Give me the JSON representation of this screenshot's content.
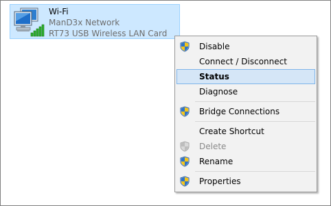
{
  "adapter": {
    "name": "Wi-Fi",
    "network": "ManD3x Network",
    "device": "RT73 USB Wireless LAN Card",
    "icon": "wireless-network-adapter-icon"
  },
  "menu": {
    "items": [
      {
        "label": "Disable",
        "shield": true,
        "disabled": false,
        "highlighted": false
      },
      {
        "label": "Connect / Disconnect",
        "shield": false,
        "disabled": false,
        "highlighted": false
      },
      {
        "label": "Status",
        "shield": false,
        "disabled": false,
        "highlighted": true
      },
      {
        "label": "Diagnose",
        "shield": false,
        "disabled": false,
        "highlighted": false
      },
      {
        "label": "Bridge Connections",
        "shield": true,
        "disabled": false,
        "highlighted": false
      },
      {
        "label": "Create Shortcut",
        "shield": false,
        "disabled": false,
        "highlighted": false
      },
      {
        "label": "Delete",
        "shield": true,
        "disabled": true,
        "highlighted": false
      },
      {
        "label": "Rename",
        "shield": true,
        "disabled": false,
        "highlighted": false
      },
      {
        "label": "Properties",
        "shield": true,
        "disabled": false,
        "highlighted": false
      }
    ]
  },
  "colors": {
    "selection_fill": "#cde8ff",
    "hover_fill": "#d5e6f7",
    "hover_border": "#7eb4ea",
    "disabled_text": "#8a8a8a",
    "signal_green": "#2fb12f"
  }
}
